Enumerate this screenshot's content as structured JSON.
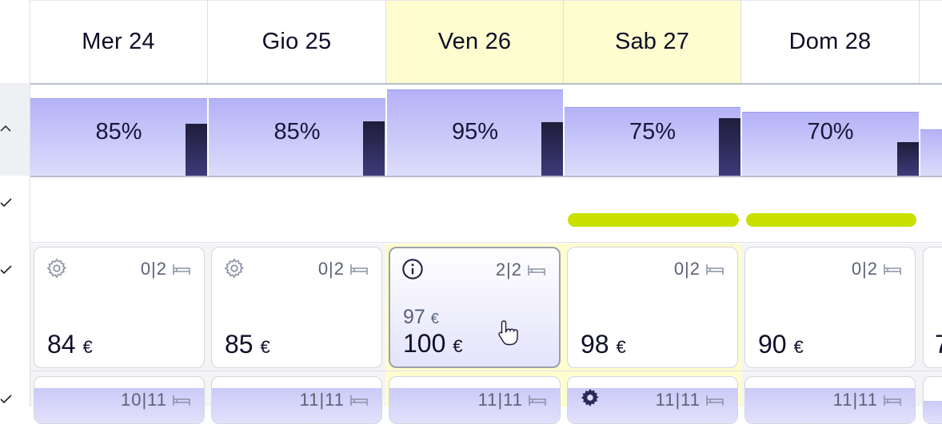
{
  "header": {
    "days": [
      {
        "label": "Mer 24",
        "weekend": false
      },
      {
        "label": "Gio 25",
        "weekend": false
      },
      {
        "label": "Ven 26",
        "weekend": true
      },
      {
        "label": "Sab 27",
        "weekend": true
      },
      {
        "label": "Dom 28",
        "weekend": false
      }
    ]
  },
  "occupancy": {
    "values": [
      "85%",
      "85%",
      "95%",
      "75%",
      "70%"
    ]
  },
  "prices": [
    {
      "icon": "gear-icon",
      "avail": "0|2",
      "price": "84",
      "currency": "€"
    },
    {
      "icon": "gear-icon",
      "avail": "0|2",
      "price": "85",
      "currency": "€"
    },
    {
      "icon": "info-icon",
      "avail": "2|2",
      "previous": "97",
      "price": "100",
      "currency": "€",
      "selected": true
    },
    {
      "icon": "",
      "avail": "0|2",
      "price": "98",
      "currency": "€"
    },
    {
      "icon": "",
      "avail": "0|2",
      "price": "90",
      "currency": "€"
    },
    {
      "partial_price": "7"
    }
  ],
  "next_row": {
    "avail": [
      "10|11",
      "11|11",
      "11|11",
      "11|11",
      "11|11"
    ]
  },
  "colors": {
    "weekend_bg": "#fdfdcf",
    "occupancy_fill": "#b4b2f7",
    "event_bar": "#c9e000",
    "accent_dark": "#1f1d3a"
  }
}
